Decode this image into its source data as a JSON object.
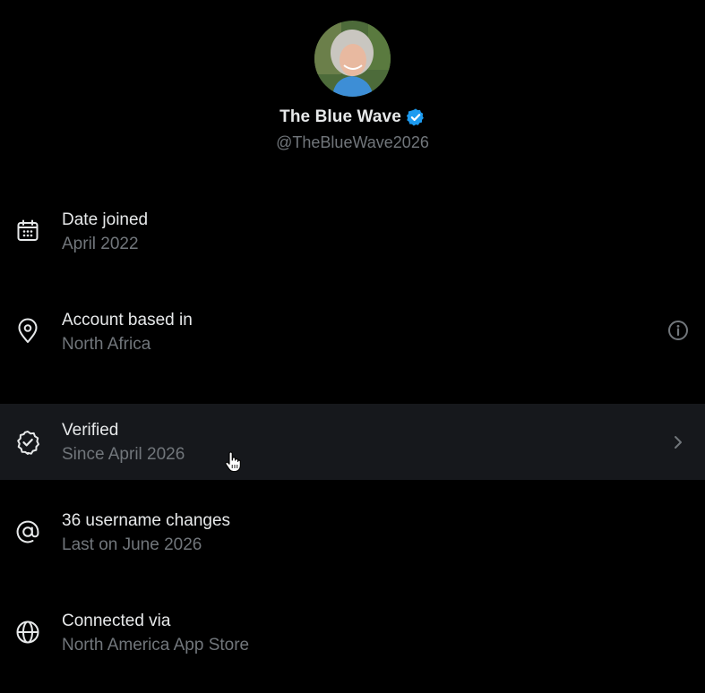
{
  "profile": {
    "display_name": "The Blue Wave",
    "handle": "@TheBlueWave2026",
    "verified_badge_icon": "verified-check-icon",
    "badge_color": "#1d9bf0"
  },
  "rows": [
    {
      "icon": "calendar-icon",
      "title": "Date joined",
      "subtitle": "April 2022"
    },
    {
      "icon": "location-pin-icon",
      "title": "Account based in",
      "subtitle": "North Africa",
      "trailing_icon": "info-icon"
    },
    {
      "icon": "verified-badge-outline-icon",
      "title": "Verified",
      "subtitle": "Since April 2026",
      "trailing_icon": "chevron-right-icon",
      "hovered": true
    },
    {
      "icon": "at-sign-icon",
      "title": "36 username changes",
      "subtitle": "Last on June 2026"
    },
    {
      "icon": "globe-icon",
      "title": "Connected via",
      "subtitle": "North America App Store"
    }
  ],
  "colors": {
    "background": "#000000",
    "primary_text": "#e7e9ea",
    "secondary_text": "#71767b",
    "hover_row": "#16181c"
  }
}
